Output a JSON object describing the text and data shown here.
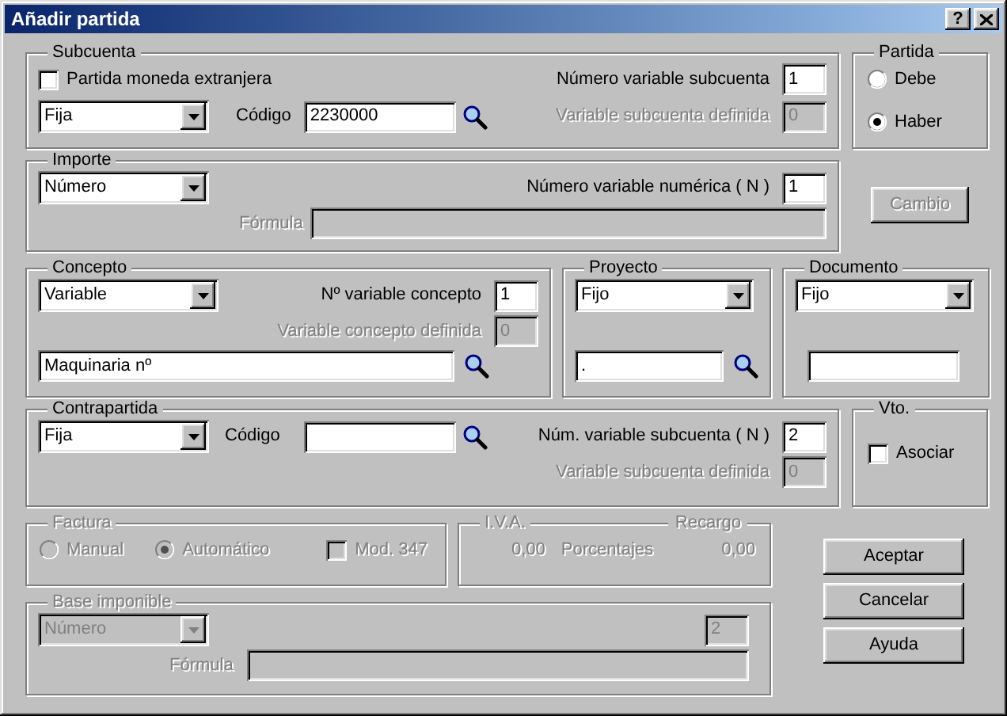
{
  "window": {
    "title": "Añadir partida",
    "help_button": "?"
  },
  "subcuenta": {
    "label": "Subcuenta",
    "foreign_currency": {
      "label": "Partida moneda extranjera",
      "checked": false
    },
    "type": {
      "value": "Fija"
    },
    "codigo": {
      "label": "Código",
      "value": "2230000"
    },
    "variable_number": {
      "label": "Número variable subcuenta",
      "value": "1"
    },
    "defined_variable": {
      "label": "Variable subcuenta definida",
      "value": "0",
      "disabled": true
    }
  },
  "partida": {
    "label": "Partida",
    "options": [
      {
        "label": "Debe",
        "selected": false
      },
      {
        "label": "Haber",
        "selected": true
      }
    ]
  },
  "importe": {
    "label": "Importe",
    "type": {
      "value": "Número"
    },
    "variable_number": {
      "label": "Número variable numérica ( N )",
      "value": "1"
    },
    "formula": {
      "label": "Fórmula",
      "disabled": true
    }
  },
  "cambio_button": {
    "label": "Cambio",
    "disabled": true
  },
  "concepto": {
    "label": "Concepto",
    "type": {
      "value": "Variable"
    },
    "variable_number": {
      "label": "Nº variable concepto",
      "value": "1"
    },
    "defined_variable": {
      "label": "Variable concepto definida",
      "value": "0",
      "disabled": true
    },
    "text": {
      "value": "Maquinaria nº"
    }
  },
  "proyecto": {
    "label": "Proyecto",
    "type": {
      "value": "Fijo"
    },
    "code": {
      "value": "."
    }
  },
  "documento": {
    "label": "Documento",
    "type": {
      "value": "Fijo"
    }
  },
  "contrapartida": {
    "label": "Contrapartida",
    "type": {
      "value": "Fija"
    },
    "codigo": {
      "label": "Código"
    },
    "variable_number": {
      "label": "Núm. variable subcuenta ( N )",
      "value": "2"
    },
    "defined_variable": {
      "label": "Variable subcuenta definida",
      "value": "0",
      "disabled": true
    }
  },
  "vto": {
    "label": "Vto.",
    "asociar": {
      "label": "Asociar",
      "checked": false
    }
  },
  "factura": {
    "label": "Factura",
    "disabled": true,
    "options": [
      {
        "label": "Manual",
        "selected": false
      },
      {
        "label": "Automático",
        "selected": true
      }
    ],
    "mod347": {
      "label": "Mod. 347",
      "checked": false
    }
  },
  "iva": {
    "label": "I.V.A.",
    "recargo_label": "Recargo",
    "iva_value": "0,00",
    "caption": "Porcentajes",
    "recargo_value": "0,00",
    "disabled": true
  },
  "base_imponible": {
    "label": "Base imponible",
    "disabled": true,
    "type": {
      "value": "Número"
    },
    "number": {
      "value": "2"
    },
    "formula": {
      "label": "Fórmula"
    }
  },
  "buttons": [
    {
      "label": "Aceptar"
    },
    {
      "label": "Cancelar"
    },
    {
      "label": "Ayuda"
    }
  ]
}
